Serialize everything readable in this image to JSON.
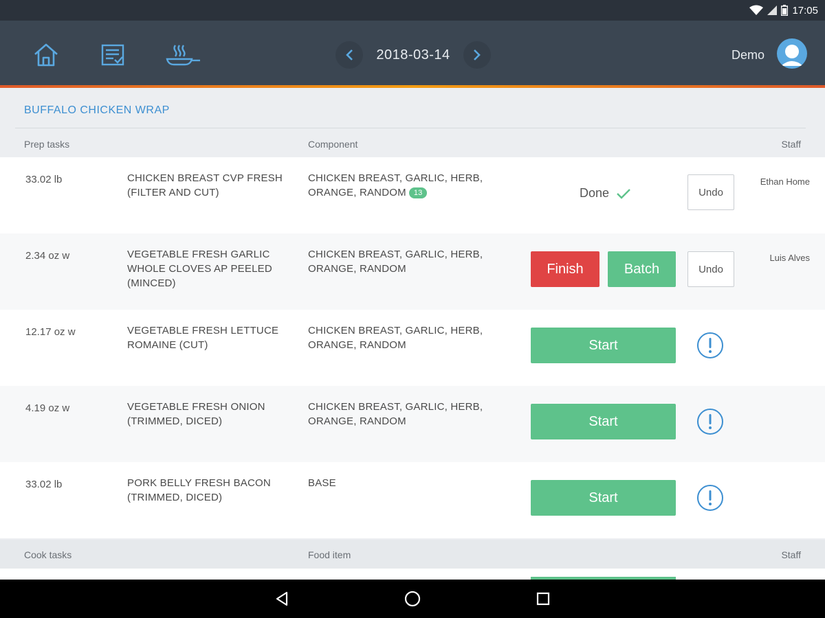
{
  "status_bar": {
    "time": "17:05",
    "icons": [
      "wifi-icon",
      "signal-icon",
      "battery-icon"
    ]
  },
  "header": {
    "nav_icons": [
      "home-icon",
      "checklist-icon",
      "cooking-pan-icon"
    ],
    "date": "2018-03-14",
    "user_name": "Demo",
    "accent_color": "#3b4652"
  },
  "recipe": {
    "title": "BUFFALO CHICKEN WRAP"
  },
  "prep_table": {
    "headers": {
      "task": "Prep tasks",
      "component": "Component",
      "staff": "Staff"
    },
    "rows": [
      {
        "qty": "33.02 lb",
        "task": "CHICKEN BREAST CVP FRESH (FILTER AND CUT)",
        "component": "CHICKEN BREAST, GARLIC, HERB, ORANGE, RANDOM",
        "badge": "13",
        "status": "Done",
        "undo": "Undo",
        "staff": "Ethan Home"
      },
      {
        "qty": "2.34 oz w",
        "task": "VEGETABLE FRESH GARLIC WHOLE CLOVES AP PEELED (MINCED)",
        "component": "CHICKEN BREAST, GARLIC, HERB, ORANGE, RANDOM",
        "finish": "Finish",
        "batch": "Batch",
        "undo": "Undo",
        "staff": "Luis Alves"
      },
      {
        "qty": "12.17 oz w",
        "task": "VEGETABLE FRESH LETTUCE ROMAINE (CUT)",
        "component": "CHICKEN BREAST, GARLIC, HERB, ORANGE, RANDOM",
        "start": "Start"
      },
      {
        "qty": "4.19 oz w",
        "task": "VEGETABLE FRESH ONION (TRIMMED, DICED)",
        "component": "CHICKEN BREAST, GARLIC, HERB, ORANGE, RANDOM",
        "start": "Start"
      },
      {
        "qty": "33.02 lb",
        "task": "PORK BELLY FRESH BACON (TRIMMED, DICED)",
        "component": "BASE",
        "start": "Start"
      }
    ]
  },
  "cook_table": {
    "headers": {
      "task": "Cook tasks",
      "food_item": "Food item",
      "staff": "Staff"
    }
  },
  "colors": {
    "green": "#5ec28b",
    "red": "#e04444",
    "blue": "#3d8fd1",
    "header": "#3b4652"
  }
}
